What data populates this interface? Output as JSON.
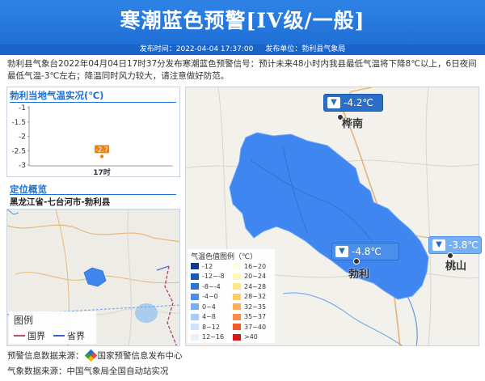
{
  "header": {
    "title": "寒潮蓝色预警[IV级/一般]",
    "publish_time_label": "发布时间：2022-04-04 17:37:00",
    "publish_unit_label": "发布单位：勃利县气象局"
  },
  "description": "勃利县气象台2022年04月04日17时37分发布寒潮蓝色预警信号：预计未来48小时内我县最低气温将下降8℃以上，6日夜间最低气温-3℃左右；降温同时风力较大，请注意做好防范。",
  "colors": {
    "banner_blue": "#2f83e6",
    "warning_region_blue": "#3f86f0",
    "accent_blue": "#1b6fd6",
    "callout_blue": "#2a6fc7",
    "point_orange": "#e2861f"
  },
  "temp_chart": {
    "title": "勃利当地气温实况(℃)",
    "chart_data": {
      "type": "scatter",
      "title": "勃利当地气温实况(℃)",
      "categories": [
        "17时"
      ],
      "values": [
        -2.7
      ],
      "ylim": [
        -3,
        -1
      ],
      "yticks": [
        "-1",
        "-1.5",
        "-2",
        "-2.5",
        "-3"
      ],
      "point_label": "-2.7"
    }
  },
  "location": {
    "title": "定位概览",
    "path": "黑龙江省-七台河市-勃利县",
    "legend_title": "图例",
    "legend_country": "国界",
    "legend_province": "省界"
  },
  "map": {
    "callouts": [
      {
        "value": "-4.2℃",
        "icon": "arrow-down-icon"
      },
      {
        "value": "-4.8℃",
        "icon": "arrow-down-icon"
      },
      {
        "value": "-3.8℃",
        "icon": "arrow-down-icon"
      }
    ],
    "cities": [
      "桦南",
      "勃利",
      "桃山"
    ],
    "legend": {
      "title": "气温色值图例（℃）",
      "items_left": [
        "-12",
        "-12~-8",
        "-8~-4",
        "-4~0",
        "0~4",
        "4~8",
        "8~12",
        "12~16"
      ],
      "items_right": [
        "16~20",
        "20~24",
        "24~28",
        "28~32",
        "32~35",
        "35~37",
        "37~40",
        ">40"
      ],
      "colors_left": [
        "#0a3c8c",
        "#1c58b8",
        "#2f72d6",
        "#4b8fea",
        "#74b0f3",
        "#a5cdf8",
        "#cde4fb",
        "#e8f4fd"
      ],
      "colors_right": [
        "#fffde0",
        "#fff8b8",
        "#ffe68a",
        "#ffcc66",
        "#ffae5c",
        "#ff8a4a",
        "#f2572d",
        "#d9141a"
      ]
    }
  },
  "footer": {
    "source_warning": "预警信息数据来源：",
    "source_warning_org": "国家预警信息发布中心",
    "source_weather": "气象数据来源：中国气象局全国自动站实况"
  }
}
